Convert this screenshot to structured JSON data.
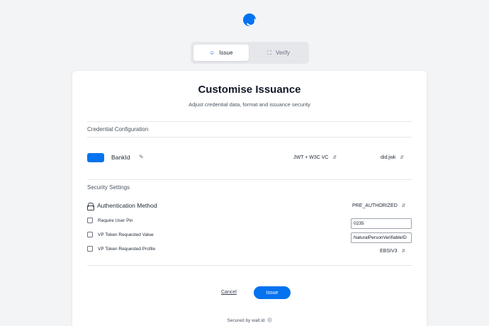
{
  "tabs": [
    {
      "label": "Issue",
      "icon": "user-icon",
      "active": true
    },
    {
      "label": "Verify",
      "icon": "scan-icon",
      "active": false
    }
  ],
  "card": {
    "title": "Customise Issuance",
    "subtitle": "Adjust credential data, format and issuance security"
  },
  "credential_config": {
    "section_title": "Credential Configuration",
    "name": "BankId",
    "format": "JWT + W3C VC",
    "did_method": "did:jwk",
    "swatch_color": "#0573f0"
  },
  "security": {
    "section_title": "Security Settings",
    "auth_label": "Authentication Method",
    "auth_value": "PRE_AUTHORIZED",
    "require_pin_label": "Require User Pin",
    "pin_value": "0235",
    "vp_value_label": "VP Token Requested Value",
    "vp_value": "NaturalPersonVerifiableID",
    "vp_profile_label": "VP Token Requested Profile",
    "vp_profile": "EBSIV3"
  },
  "actions": {
    "cancel": "Cancel",
    "issue": "Issue"
  },
  "footer": {
    "secured": "Secured by walt.id"
  },
  "colors": {
    "accent": "#0573f0",
    "background": "#f3f4f6"
  }
}
